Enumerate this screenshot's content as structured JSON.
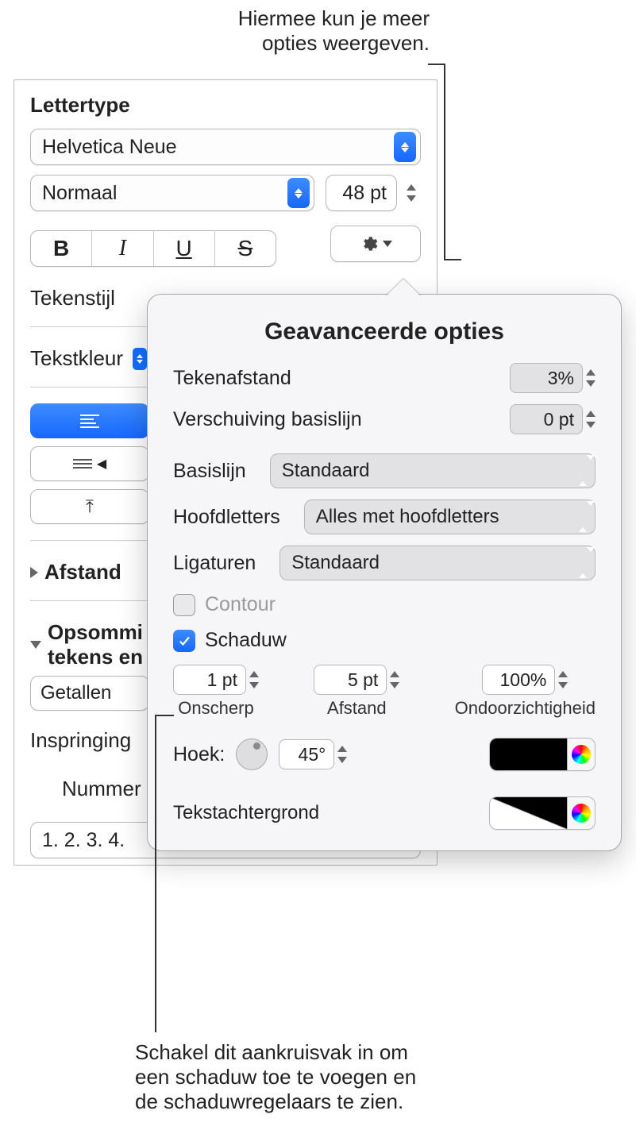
{
  "callouts": {
    "top_line1": "Hiermee kun je meer",
    "top_line2": "opties weergeven.",
    "bottom_line1": "Schakel dit aankruisvak in om",
    "bottom_line2": "een schaduw toe te voegen en",
    "bottom_line3": "de schaduwregelaars te zien."
  },
  "sidebar": {
    "section_title": "Lettertype",
    "font_name": "Helvetica Neue",
    "font_style": "Normaal",
    "font_size": "48 pt",
    "bold_glyph": "B",
    "italic_glyph": "I",
    "underline_glyph": "U",
    "strike_glyph": "S",
    "tekenstijl_label": "Tekenstijl",
    "tekstkleur_label": "Tekstkleur",
    "afstand_label": "Afstand",
    "opsomming_label_l1": "Opsommi",
    "opsomming_label_l2": "tekens en",
    "getallen_label": "Getallen",
    "inspringing_label": "Inspringing",
    "nummer_label": "Nummer",
    "number_format": "1. 2. 3. 4."
  },
  "popover": {
    "title": "Geavanceerde opties",
    "tekenafstand_label": "Tekenafstand",
    "tekenafstand_value": "3%",
    "basislijn_shift_label": "Verschuiving basislijn",
    "basislijn_shift_value": "0 pt",
    "basislijn_label": "Basislijn",
    "basislijn_value": "Standaard",
    "hoofdletters_label": "Hoofdletters",
    "hoofdletters_value": "Alles met hoofdletters",
    "ligaturen_label": "Ligaturen",
    "ligaturen_value": "Standaard",
    "contour_label": "Contour",
    "schaduw_label": "Schaduw",
    "shadow_blur_value": "1 pt",
    "shadow_blur_caption": "Onscherp",
    "shadow_offset_value": "5 pt",
    "shadow_offset_caption": "Afstand",
    "shadow_opacity_value": "100%",
    "shadow_opacity_caption": "Ondoorzichtigheid",
    "hoek_label": "Hoek:",
    "hoek_value": "45°",
    "tekstachtergrond_label": "Tekstachtergrond"
  }
}
